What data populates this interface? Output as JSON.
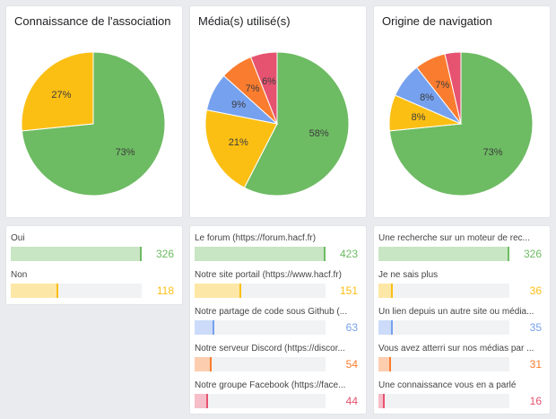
{
  "charts": [
    {
      "title": "Connaissance de l'association",
      "slices": [
        {
          "label": "Oui",
          "value": 326,
          "pct": "73%",
          "color": "#6dbb63"
        },
        {
          "label": "Non",
          "value": 118,
          "pct": "27%",
          "color": "#fbbf14"
        }
      ]
    },
    {
      "title": "Média(s) utilisé(s)",
      "slices": [
        {
          "label": "Le forum (https://forum.hacf.fr)",
          "value": 423,
          "pct": "58%",
          "color": "#6dbb63"
        },
        {
          "label": "Notre site portail (https://www.hacf.fr)",
          "value": 151,
          "pct": "21%",
          "color": "#fbbf14"
        },
        {
          "label": "Notre partage de code sous Github (...",
          "value": 63,
          "pct": "9%",
          "color": "#76a1ee"
        },
        {
          "label": "Notre serveur Discord (https://discor...",
          "value": 54,
          "pct": "7%",
          "color": "#fa7c2e"
        },
        {
          "label": "Notre groupe Facebook (https://face...",
          "value": 44,
          "pct": "6%",
          "color": "#e65370"
        }
      ]
    },
    {
      "title": "Origine de navigation",
      "slices": [
        {
          "label": "Une recherche sur un moteur de rec...",
          "value": 326,
          "pct": "73%",
          "color": "#6dbb63"
        },
        {
          "label": "Je ne sais plus",
          "value": 36,
          "pct": "8%",
          "color": "#fbbf14"
        },
        {
          "label": "Un lien depuis un autre site ou média...",
          "value": 35,
          "pct": "8%",
          "color": "#76a1ee"
        },
        {
          "label": "Vous avez atterri sur nos médias par ...",
          "value": 31,
          "pct": "7%",
          "color": "#fa7c2e"
        },
        {
          "label": "Une connaissance vous en a parlé",
          "value": 16,
          "pct": "",
          "color": "#e65370"
        }
      ]
    }
  ],
  "chart_data": [
    {
      "type": "pie",
      "title": "Connaissance de l'association",
      "categories": [
        "Oui",
        "Non"
      ],
      "values": [
        326,
        118
      ]
    },
    {
      "type": "pie",
      "title": "Média(s) utilisé(s)",
      "categories": [
        "Le forum (https://forum.hacf.fr)",
        "Notre site portail (https://www.hacf.fr)",
        "Notre partage de code sous Github (...",
        "Notre serveur Discord (https://discor...",
        "Notre groupe Facebook (https://face..."
      ],
      "values": [
        423,
        151,
        63,
        54,
        44
      ]
    },
    {
      "type": "pie",
      "title": "Origine de navigation",
      "categories": [
        "Une recherche sur un moteur de rec...",
        "Je ne sais plus",
        "Un lien depuis un autre site ou média...",
        "Vous avez atterri sur nos médias par ...",
        "Une connaissance vous en a parlé"
      ],
      "values": [
        326,
        36,
        35,
        31,
        16
      ]
    }
  ]
}
